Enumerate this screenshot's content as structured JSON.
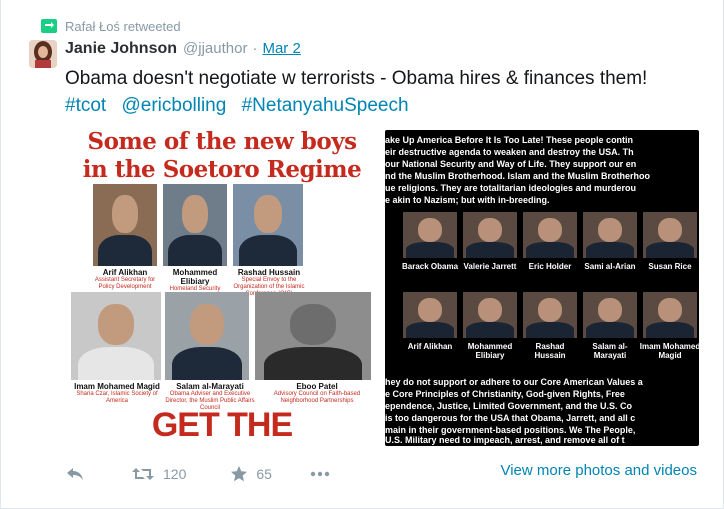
{
  "retweet": {
    "text": "Rafał Łoś retweeted"
  },
  "tweet": {
    "fullname": "Janie Johnson",
    "username": "@jjauthor",
    "time": "Mar 2",
    "text": "Obama doesn't negotiate w terrorists - Obama hires & finances them!",
    "hashtags": [
      "#tcot",
      "@ericbolling",
      "#NetanyahuSpeech"
    ]
  },
  "photo1": {
    "headline_line1": "Some of the new boys",
    "headline_line2": "in the Soetoro Regime",
    "people": [
      {
        "name": "Arif Alikhan",
        "role": "Assistant Secretary for Policy Development"
      },
      {
        "name": "Mohammed Elibiary",
        "role": "Homeland Security Adviser"
      },
      {
        "name": "Rashad Hussain",
        "role": "Special Envoy to the Organization of the Islamic Conference (OIC)"
      },
      {
        "name": "Imam Mohamed Magid",
        "role": "Sharia Czar, Islamic Society of America"
      },
      {
        "name": "Salam al-Marayati",
        "role": "Obama Adviser and Executive Director, the Muslim Public Affairs Council"
      },
      {
        "name": "Eboo Patel",
        "role": "Advisory Council on Faith-based Neighborhood Partnerships"
      }
    ],
    "footer": "GET THE PICTURE?!!!"
  },
  "photo2": {
    "top_lines": [
      "ake Up America Before It Is Too Late! These people contin",
      "eir destructive agenda to weaken and destroy the USA. Th",
      "our National Security and Way of Life. They support our en",
      "nd the Muslim Brotherhood. Islam and the Muslim Brotherhoo",
      "ue religions. They are totalitarian ideologies and murderou",
      "e akin to Nazism; but with in-breeding."
    ],
    "row1": [
      "Barack Obama",
      "Valerie Jarrett",
      "Eric Holder",
      "Sami al-Arian",
      "Susan Rice"
    ],
    "row2": [
      "Arif Alikhan",
      "Mohammed Elibiary",
      "Rashad Hussain",
      "Salam al-Marayati",
      "Imam Mohamed Magid"
    ],
    "bottom_lines": [
      "hey do not support or adhere to our Core American Values a",
      "e Core Principles of Christianity, God-given Rights, Free",
      "ependence, Justice, Limited Government, and the U.S. Co",
      "is too dangerous for the USA that Obama, Jarrett, and all c",
      "main in their government-based positions. We The People,",
      "U.S. Military need to impeach, arrest, and remove all of t"
    ]
  },
  "actions": {
    "retweets": "120",
    "favorites": "65"
  },
  "more_link": "View more photos and videos",
  "colors": {
    "link": "#0084b4",
    "muted": "#8899a6",
    "retweet_green": "#19cf86",
    "headline_red": "#c52a1e"
  }
}
